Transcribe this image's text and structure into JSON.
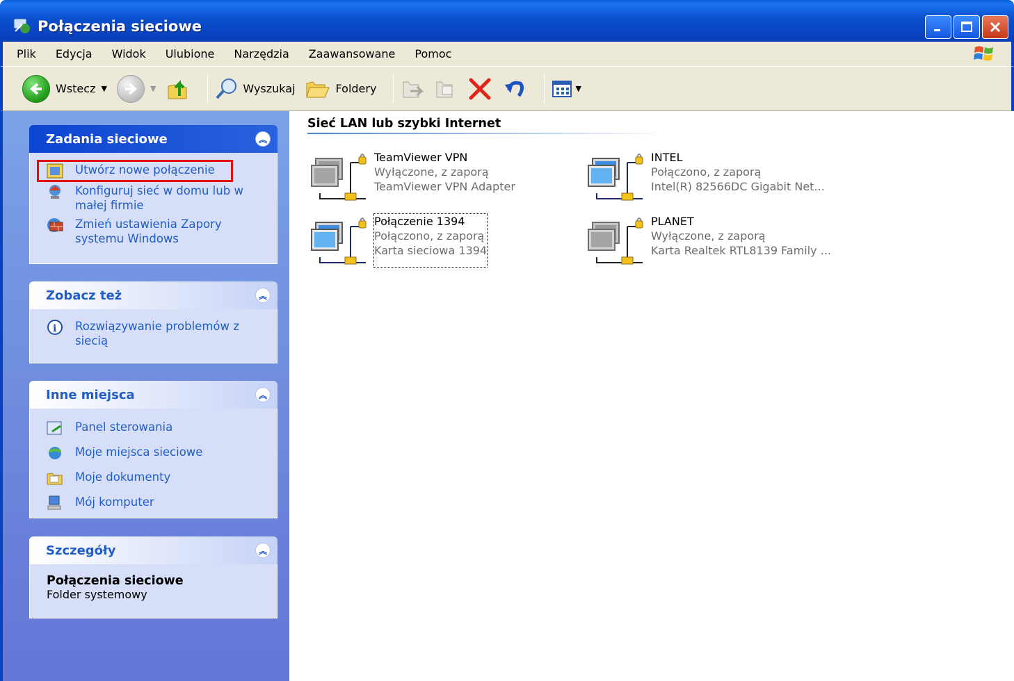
{
  "window": {
    "title": "Połączenia sieciowe"
  },
  "menu": [
    "Plik",
    "Edycja",
    "Widok",
    "Ulubione",
    "Narzędzia",
    "Zaawansowane",
    "Pomoc"
  ],
  "toolbar": {
    "back_label": "Wstecz",
    "search_label": "Wyszukaj",
    "folders_label": "Foldery"
  },
  "sidebar": {
    "network_tasks": {
      "title": "Zadania sieciowe",
      "items": [
        "Utwórz nowe połączenie",
        "Konfiguruj sieć w domu lub w małej firmie",
        "Zmień ustawienia Zapory systemu Windows"
      ]
    },
    "see_also": {
      "title": "Zobacz też",
      "items": [
        "Rozwiązywanie problemów z siecią"
      ]
    },
    "other_places": {
      "title": "Inne miejsca",
      "items": [
        "Panel sterowania",
        "Moje miejsca sieciowe",
        "Moje dokumenty",
        "Mój komputer"
      ]
    },
    "details": {
      "title": "Szczegóły",
      "name": "Połączenia sieciowe",
      "type": "Folder systemowy"
    }
  },
  "main": {
    "group_title": "Sieć LAN lub szybki Internet",
    "connections": [
      {
        "name": "TeamViewer VPN",
        "status": "Wyłączone, z zaporą",
        "adapter": "TeamViewer VPN Adapter",
        "enabled": false
      },
      {
        "name": "INTEL",
        "status": "Połączono, z zaporą",
        "adapter": "Intel(R) 82566DC Gigabit Net...",
        "enabled": true
      },
      {
        "name": "Połączenie 1394",
        "status": "Połączono, z zaporą",
        "adapter": "Karta sieciowa 1394",
        "enabled": true,
        "selected": true
      },
      {
        "name": "PLANET",
        "status": "Wyłączone, z zaporą",
        "adapter": "Karta Realtek RTL8139 Family ...",
        "enabled": false
      }
    ]
  },
  "colors": {
    "titlebar": "#0842c0",
    "link": "#215dc6",
    "panel": "#d6dff7",
    "highlight": "#e01010"
  }
}
